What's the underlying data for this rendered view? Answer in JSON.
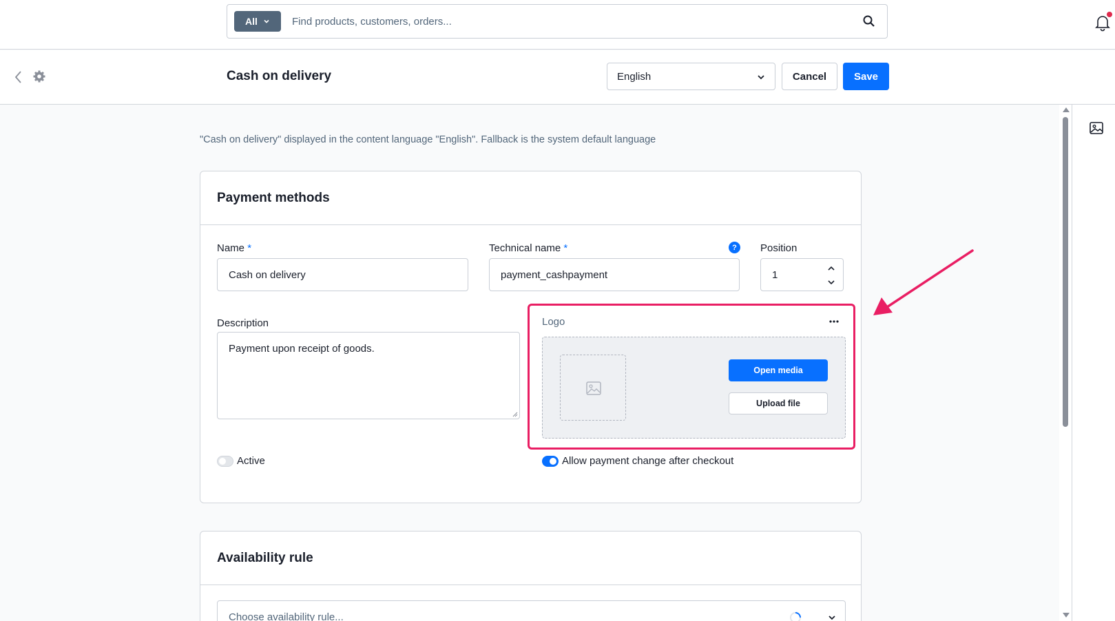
{
  "topbar": {
    "search_type": "All",
    "search_placeholder": "Find products, customers, orders..."
  },
  "smartbar": {
    "title": "Cash on delivery",
    "language": "English",
    "cancel_label": "Cancel",
    "save_label": "Save"
  },
  "info_text": "\"Cash on delivery\" displayed in the content language \"English\". Fallback is the system default language",
  "payment_card": {
    "title": "Payment methods",
    "name_label": "Name",
    "name_value": "Cash on delivery",
    "technical_name_label": "Technical name",
    "technical_name_value": "payment_cashpayment",
    "required_marker": "*",
    "help_glyph": "?",
    "position_label": "Position",
    "position_value": "1",
    "description_label": "Description",
    "description_value": "Payment upon receipt of goods.",
    "logo_label": "Logo",
    "open_media_label": "Open media",
    "upload_file_label": "Upload file",
    "active_label": "Active",
    "active_on": false,
    "allow_change_label": "Allow payment change after checkout",
    "allow_change_on": true
  },
  "availability_card": {
    "title": "Availability rule",
    "rule_placeholder": "Choose availability rule..."
  },
  "colors": {
    "accent": "#0870ff",
    "highlight": "#e91e63",
    "notification": "#de294c"
  },
  "icons": [
    "chevron-down-icon",
    "search-icon",
    "bell-icon",
    "back-icon",
    "gear-icon",
    "media-icon",
    "help-icon",
    "image-placeholder-icon",
    "more-dots-icon",
    "spinner-icon"
  ]
}
